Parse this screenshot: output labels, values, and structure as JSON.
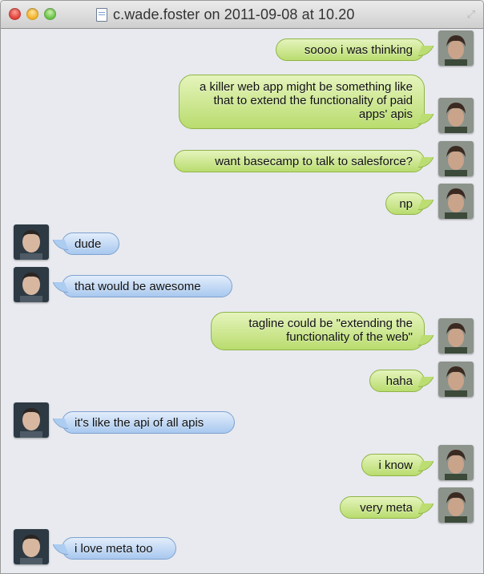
{
  "window": {
    "title": "c.wade.foster on 2011-09-08 at 10.20"
  },
  "icons": {
    "close": "close-traffic-light-icon",
    "minimize": "minimize-traffic-light-icon",
    "zoom": "zoom-traffic-light-icon",
    "document": "document-icon",
    "fullscreen": "fullscreen-resize-icon"
  },
  "colors": {
    "outgoing_bubble": "#c8e486",
    "incoming_bubble": "#b8d3f3"
  },
  "messages": [
    {
      "side": "right",
      "text": "soooo i was thinking"
    },
    {
      "side": "right",
      "text": "a killer web app might be something like that to extend the functionality of paid apps' apis"
    },
    {
      "side": "right",
      "text": "want basecamp to talk to salesforce?"
    },
    {
      "side": "right",
      "text": "np"
    },
    {
      "side": "left",
      "text": "dude"
    },
    {
      "side": "left",
      "text": "that would be awesome"
    },
    {
      "side": "right",
      "text": "tagline could be \"extending the functionality of the web\""
    },
    {
      "side": "right",
      "text": "haha"
    },
    {
      "side": "left",
      "text": "it's like the api of all apis"
    },
    {
      "side": "right",
      "text": "i know"
    },
    {
      "side": "right",
      "text": "very meta"
    },
    {
      "side": "left",
      "text": "i love meta too"
    }
  ]
}
